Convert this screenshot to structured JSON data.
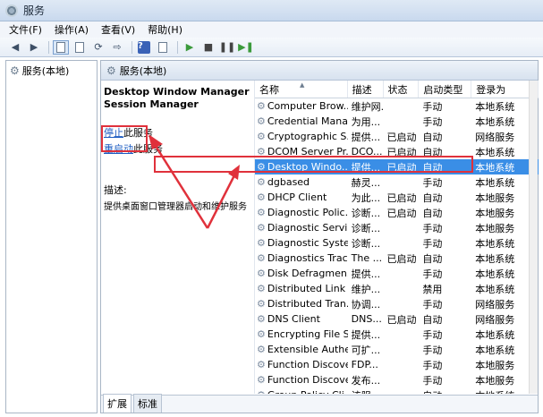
{
  "window": {
    "title": "服务"
  },
  "menu": [
    "文件(F)",
    "操作(A)",
    "查看(V)",
    "帮助(H)"
  ],
  "toolbar_icons": [
    "back-icon",
    "forward-icon",
    "console-tree-icon",
    "properties-icon",
    "refresh-icon",
    "export-icon",
    "help-icon",
    "properties-2-icon",
    "start-icon",
    "stop-icon",
    "pause-icon",
    "restart-icon"
  ],
  "left_pane": {
    "root": "服务(本地)"
  },
  "right_pane": {
    "header": "服务(本地)",
    "selected_service": "Desktop Window Manager Session Manager",
    "action_stop_link": "停止",
    "action_stop_suffix": "此服务",
    "action_restart_link": "重启动",
    "action_restart_suffix": "此服务",
    "description_label": "描述:",
    "description_text": "提供桌面窗口管理器启动和维护服务"
  },
  "table": {
    "columns": [
      "名称",
      "描述",
      "状态",
      "启动类型",
      "登录为"
    ],
    "rows": [
      {
        "name": "Computer Brow...",
        "desc": "维护网...",
        "status": "",
        "start": "手动",
        "logon": "本地系统"
      },
      {
        "name": "Credential Mana...",
        "desc": "为用...",
        "status": "",
        "start": "手动",
        "logon": "本地系统"
      },
      {
        "name": "Cryptographic S...",
        "desc": "提供...",
        "status": "已启动",
        "start": "自动",
        "logon": "网络服务"
      },
      {
        "name": "DCOM Server Pr...",
        "desc": "DCO...",
        "status": "已启动",
        "start": "自动",
        "logon": "本地系统"
      },
      {
        "name": "Desktop Windo...",
        "desc": "提供...",
        "status": "已启动",
        "start": "自动",
        "logon": "本地系统"
      },
      {
        "name": "dgbased",
        "desc": "赫灵...",
        "status": "",
        "start": "手动",
        "logon": "本地系统"
      },
      {
        "name": "DHCP Client",
        "desc": "为此...",
        "status": "已启动",
        "start": "自动",
        "logon": "本地服务"
      },
      {
        "name": "Diagnostic Polic...",
        "desc": "诊断...",
        "status": "已启动",
        "start": "自动",
        "logon": "本地服务"
      },
      {
        "name": "Diagnostic Servi...",
        "desc": "诊断...",
        "status": "",
        "start": "手动",
        "logon": "本地服务"
      },
      {
        "name": "Diagnostic Syste...",
        "desc": "诊断...",
        "status": "",
        "start": "手动",
        "logon": "本地系统"
      },
      {
        "name": "Diagnostics Trac...",
        "desc": "The ...",
        "status": "已启动",
        "start": "自动",
        "logon": "本地系统"
      },
      {
        "name": "Disk Defragmen...",
        "desc": "提供...",
        "status": "",
        "start": "手动",
        "logon": "本地系统"
      },
      {
        "name": "Distributed Link ...",
        "desc": "维护...",
        "status": "",
        "start": "禁用",
        "logon": "本地系统"
      },
      {
        "name": "Distributed Tran...",
        "desc": "协调...",
        "status": "",
        "start": "手动",
        "logon": "网络服务"
      },
      {
        "name": "DNS Client",
        "desc": "DNS...",
        "status": "已启动",
        "start": "自动",
        "logon": "网络服务"
      },
      {
        "name": "Encrypting File S...",
        "desc": "提供...",
        "status": "",
        "start": "手动",
        "logon": "本地系统"
      },
      {
        "name": "Extensible Authe...",
        "desc": "可扩...",
        "status": "",
        "start": "手动",
        "logon": "本地系统"
      },
      {
        "name": "Function Discove...",
        "desc": "FDP...",
        "status": "",
        "start": "手动",
        "logon": "本地服务"
      },
      {
        "name": "Function Discove...",
        "desc": "发布...",
        "status": "",
        "start": "手动",
        "logon": "本地服务"
      },
      {
        "name": "Group Policy Cli...",
        "desc": "该服...",
        "status": "",
        "start": "自动",
        "logon": "本地系统"
      }
    ]
  },
  "tabs": [
    "扩展",
    "标准"
  ],
  "colors": {
    "highlight": "#e0313b",
    "selection": "#3a8ee6",
    "link": "#1c5bc1"
  }
}
